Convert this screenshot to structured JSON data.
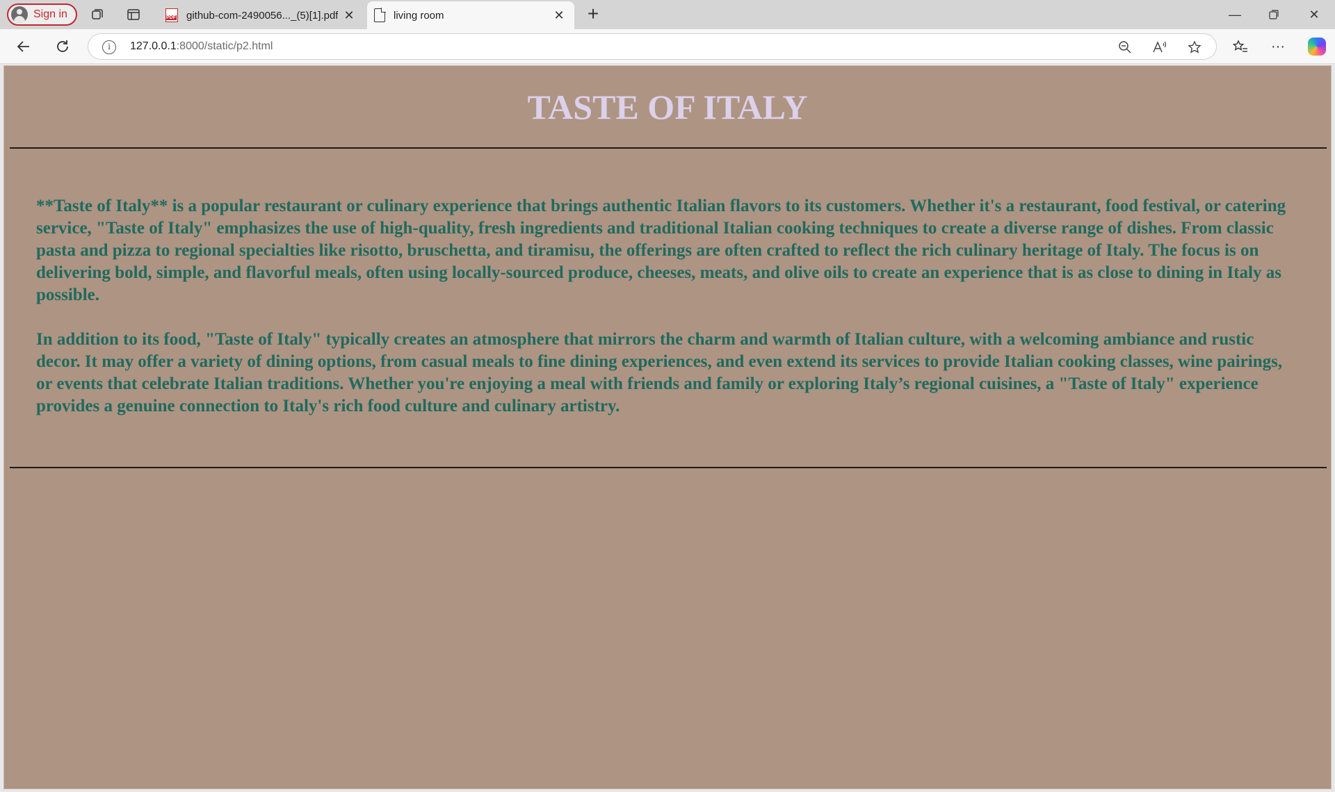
{
  "browser": {
    "signin_label": "Sign in",
    "tabs": [
      {
        "title": "github-com-2490056..._(5)[1].pdf",
        "icon": "pdf-icon",
        "active": false
      },
      {
        "title": "living room",
        "icon": "page-icon",
        "active": true
      }
    ],
    "address": {
      "host": "127.0.0.1",
      "path": ":8000/static/p2.html"
    }
  },
  "page": {
    "title": "TASTE OF ITALY",
    "paragraphs": [
      "**Taste of Italy** is a popular restaurant or culinary experience that brings authentic Italian flavors to its customers. Whether it's a restaurant, food festival, or catering service, \"Taste of Italy\" emphasizes the use of high-quality, fresh ingredients and traditional Italian cooking techniques to create a diverse range of dishes. From classic pasta and pizza to regional specialties like risotto, bruschetta, and tiramisu, the offerings are often crafted to reflect the rich culinary heritage of Italy. The focus is on delivering bold, simple, and flavorful meals, often using locally-sourced produce, cheeses, meats, and olive oils to create an experience that is as close to dining in Italy as possible.",
      "In addition to its food, \"Taste of Italy\" typically creates an atmosphere that mirrors the charm and warmth of Italian culture, with a welcoming ambiance and rustic decor. It may offer a variety of dining options, from casual meals to fine dining experiences, and even extend its services to provide Italian cooking classes, wine pairings, or events that celebrate Italian traditions. Whether you're enjoying a meal with friends and family or exploring Italy’s regional cuisines, a \"Taste of Italy\" experience provides a genuine connection to Italy's rich food culture and culinary artistry."
    ]
  },
  "colors": {
    "page_background": "#ae9483",
    "title_color": "#dcd0ea",
    "text_color": "#1f6a5e"
  }
}
